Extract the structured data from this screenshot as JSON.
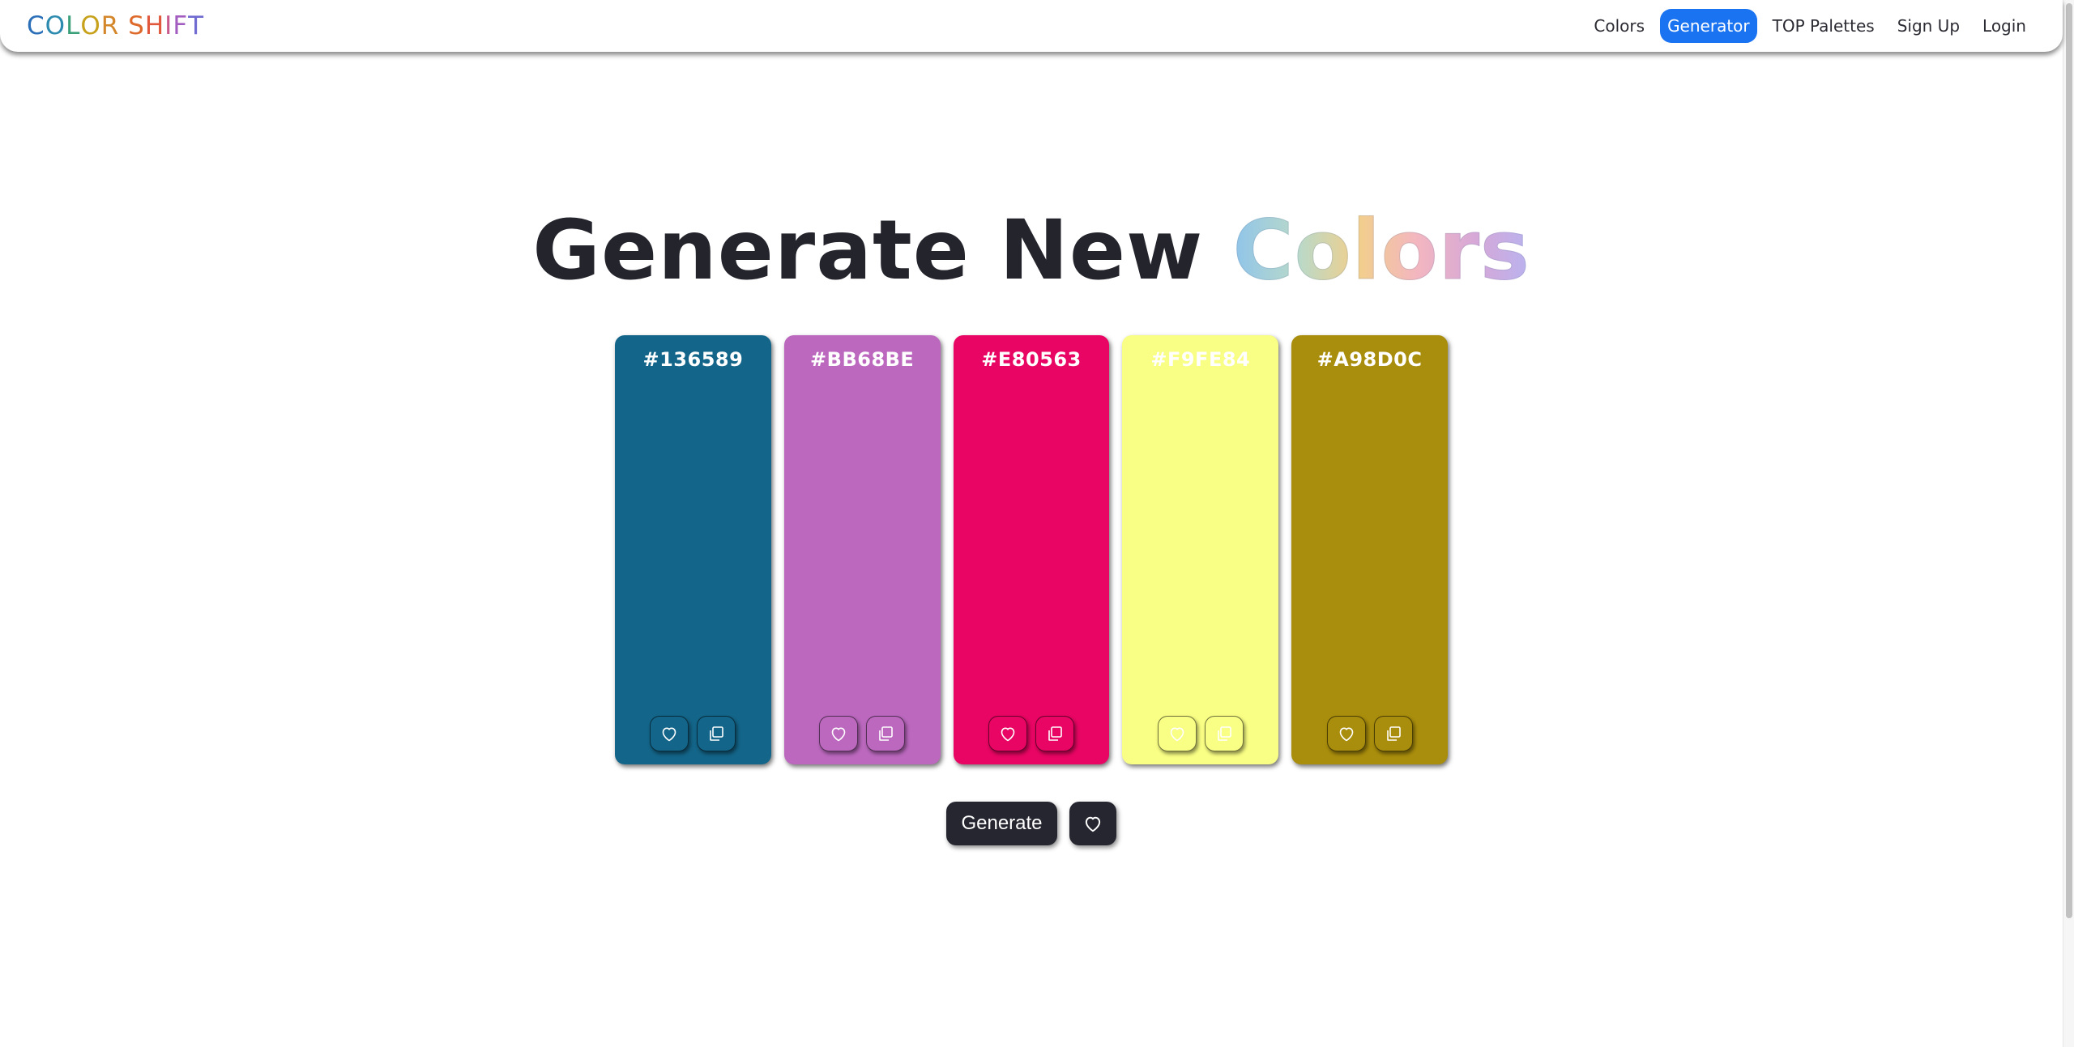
{
  "logo": {
    "letters": [
      {
        "ch": "C",
        "color": "#2a6fb8"
      },
      {
        "ch": "O",
        "color": "#2d8bb0"
      },
      {
        "ch": "L",
        "color": "#3aa07a"
      },
      {
        "ch": "O",
        "color": "#c7a11a"
      },
      {
        "ch": "R",
        "color": "#d4862a"
      },
      {
        "ch": " ",
        "color": "#ffffff"
      },
      {
        "ch": "S",
        "color": "#dd6a2a"
      },
      {
        "ch": "H",
        "color": "#e0573c"
      },
      {
        "ch": "I",
        "color": "#c85a8e"
      },
      {
        "ch": "F",
        "color": "#a35cbf"
      },
      {
        "ch": "T",
        "color": "#6f6ad0"
      }
    ]
  },
  "nav": {
    "colors": "Colors",
    "generator": "Generator",
    "top_palettes": "TOP Palettes",
    "sign_up": "Sign Up",
    "login": "Login"
  },
  "headline": {
    "prefix": "Generate New ",
    "highlight": "Colors"
  },
  "swatches": [
    {
      "hex": "#136589",
      "color": "#136589",
      "text_color": "#ffffff"
    },
    {
      "hex": "#BB68BE",
      "color": "#BB68BE",
      "text_color": "#ffffff"
    },
    {
      "hex": "#E80563",
      "color": "#E80563",
      "text_color": "#ffffff"
    },
    {
      "hex": "#F9FE84",
      "color": "#F9FE84",
      "text_color": "#ffffff"
    },
    {
      "hex": "#A98D0C",
      "color": "#A98D0C",
      "text_color": "#ffffff"
    }
  ],
  "controls": {
    "generate_label": "Generate"
  },
  "icons": {
    "heart": "heart-icon",
    "copy": "copy-icon"
  },
  "colors": {
    "accent": "#1a73f0",
    "dark_button": "#262630"
  }
}
